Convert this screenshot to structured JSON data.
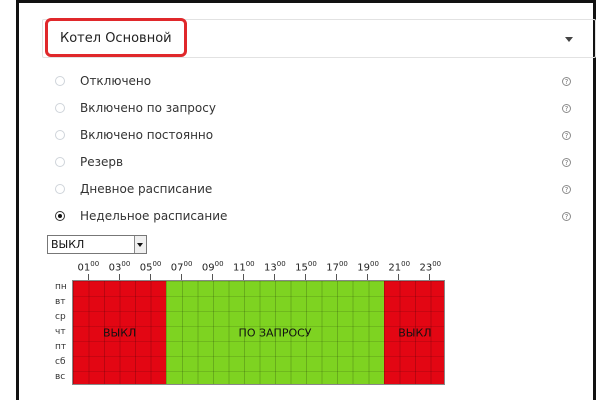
{
  "device": {
    "selected": "Котел Основной"
  },
  "modes": [
    {
      "label": "Отключено",
      "checked": false
    },
    {
      "label": "Включено по запросу",
      "checked": false
    },
    {
      "label": "Включено постоянно",
      "checked": false
    },
    {
      "label": "Резерв",
      "checked": false
    },
    {
      "label": "Дневное расписание",
      "checked": false
    },
    {
      "label": "Недельное расписание",
      "checked": true
    }
  ],
  "help_icon_glyph": "?",
  "schedule": {
    "mode_value": "ВЫКЛ",
    "hours": [
      "01",
      "03",
      "05",
      "07",
      "09",
      "11",
      "13",
      "15",
      "17",
      "19",
      "21",
      "23"
    ],
    "hours_sup": "00",
    "days": [
      "пн",
      "вт",
      "ср",
      "чт",
      "пт",
      "сб",
      "вс"
    ],
    "segments": [
      {
        "label": "ВЫКЛ",
        "from_hour": 0,
        "to_hour": 6,
        "color": "#e30613"
      },
      {
        "label": "ПО ЗАПРОСУ",
        "from_hour": 6,
        "to_hour": 20,
        "color": "#7ed321"
      },
      {
        "label": "ВЫКЛ",
        "from_hour": 20,
        "to_hour": 24,
        "color": "#e30613"
      }
    ]
  },
  "colors": {
    "highlight": "#e0282b"
  }
}
